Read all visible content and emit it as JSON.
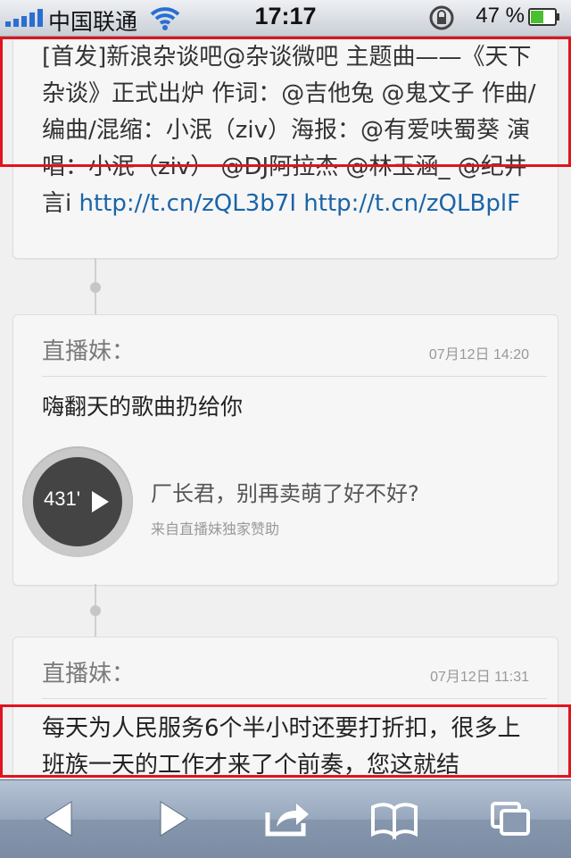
{
  "status_bar": {
    "carrier": "中国联通",
    "time": "17:17",
    "battery_percent": "47 %"
  },
  "feed": {
    "post1": {
      "text": "[首发]新浪杂谈吧@杂谈微吧 主题曲——《天下杂谈》正式出炉 作词：@吉他兔 @鬼文子 作曲/编曲/混缩：小泯（ziv）海报：@有爱呋蜀葵 演唱：小泯（ziv） @DJ阿拉杰 @林玉涵_ @纪井言i",
      "link1": "http://t.cn/zQL3b7I",
      "link2": "http://t.cn/zQLBplF"
    },
    "post2": {
      "author": "直播妹：",
      "date": "07月12日 14:20",
      "message": "嗨翻天的歌曲扔给你",
      "audio": {
        "duration": "431'",
        "title": "厂长君，别再卖萌了好不好?",
        "subtitle": "来自直播妹独家赞助"
      }
    },
    "post3": {
      "author": "直播妹：",
      "date": "07月12日 11:31",
      "text": "每天为人民服务6个半小时还要打折扣，很多上班族一天的工作才来了个前奏，您这就结"
    }
  },
  "colors": {
    "highlight": "#e0141e",
    "link": "#1a64a8"
  },
  "toolbar": {
    "icons": [
      "back-arrow-icon",
      "forward-arrow-icon",
      "share-icon",
      "bookmarks-icon",
      "pages-icon"
    ]
  }
}
